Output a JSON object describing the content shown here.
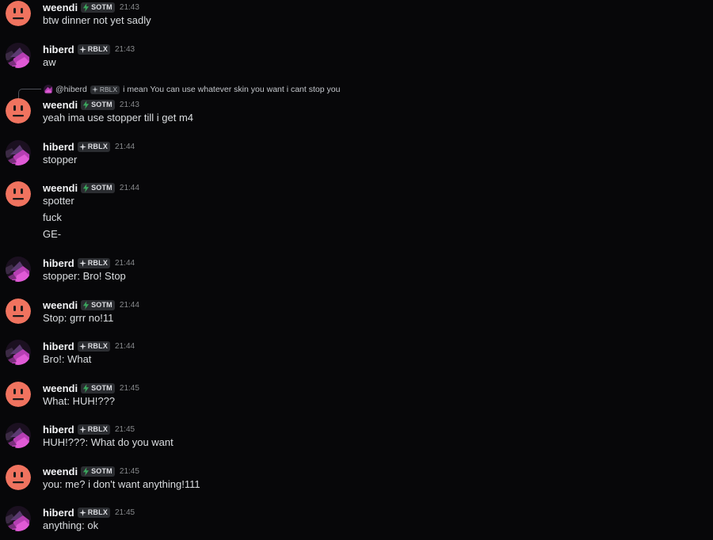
{
  "users": {
    "weendi": {
      "name": "weendi",
      "tag": "SOTM",
      "avatar_color": "#f0735f"
    },
    "hiberd": {
      "name": "hiberd",
      "tag": "RBLX",
      "avatar_color": "#b63fb3"
    }
  },
  "colors": {
    "background": "#070709",
    "username": "#f2f3f5",
    "text": "#dbdee1",
    "timestamp": "#87898c",
    "sotm_bolt": "#3ba55d"
  },
  "reply": {
    "mention": "@hiberd",
    "tag": "RBLX",
    "text": "i mean You can use whatever skin you want i cant stop you"
  },
  "messages": [
    {
      "author": "weendi",
      "tag": "SOTM",
      "time": "21:43",
      "lines": [
        "btw dinner not yet sadly"
      ]
    },
    {
      "author": "hiberd",
      "tag": "RBLX",
      "time": "21:43",
      "lines": [
        "aw"
      ]
    },
    {
      "author": "weendi",
      "tag": "SOTM",
      "time": "21:43",
      "lines": [
        "yeah ima use stopper till i get m4"
      ]
    },
    {
      "author": "hiberd",
      "tag": "RBLX",
      "time": "21:44",
      "lines": [
        "stopper"
      ]
    },
    {
      "author": "weendi",
      "tag": "SOTM",
      "time": "21:44",
      "lines": [
        "spotter",
        "fuck",
        "GE-"
      ]
    },
    {
      "author": "hiberd",
      "tag": "RBLX",
      "time": "21:44",
      "lines": [
        "stopper: Bro! Stop"
      ]
    },
    {
      "author": "weendi",
      "tag": "SOTM",
      "time": "21:44",
      "lines": [
        "Stop: grrr no!11"
      ]
    },
    {
      "author": "hiberd",
      "tag": "RBLX",
      "time": "21:44",
      "lines": [
        "Bro!: What"
      ]
    },
    {
      "author": "weendi",
      "tag": "SOTM",
      "time": "21:45",
      "lines": [
        "What: HUH!???"
      ]
    },
    {
      "author": "hiberd",
      "tag": "RBLX",
      "time": "21:45",
      "lines": [
        "HUH!???: What do you want"
      ]
    },
    {
      "author": "weendi",
      "tag": "SOTM",
      "time": "21:45",
      "lines": [
        "you: me? i don't want anything!111"
      ]
    },
    {
      "author": "hiberd",
      "tag": "RBLX",
      "time": "21:45",
      "lines": [
        "anything: ok"
      ]
    }
  ]
}
